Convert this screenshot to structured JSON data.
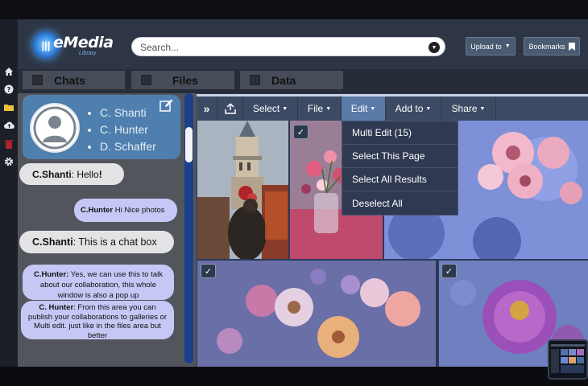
{
  "header": {
    "logo_text": "eMedia",
    "logo_sub": "Library",
    "search_placeholder": "Search...",
    "upload_label": "Upload to",
    "bookmarks_label": "Bookmarks"
  },
  "tabs": [
    {
      "label": "Chats"
    },
    {
      "label": "Files"
    },
    {
      "label": "Data"
    }
  ],
  "rail_icons": [
    "home-icon",
    "help-icon",
    "folder-icon",
    "cloud-upload-icon",
    "trash-icon",
    "settings-icon"
  ],
  "chat": {
    "contacts": [
      "C. Shanti",
      "C. Hunter",
      "D. Schaffer"
    ],
    "messages": [
      {
        "sender": "C.Shanti",
        "text": ": Hello",
        "tail": "!"
      },
      {
        "sender": "C.Hunter",
        "text": " Hi Nice photos"
      },
      {
        "sender": "C.Shanti",
        "text": ": This is a chat box"
      },
      {
        "sender": "C.Hunter:",
        "text": " Yes, we can use this to talk about our collaboration, this whole window is also a pop up"
      },
      {
        "sender": "C. Hunter",
        "text": ": From this area you can publish your collaborations to galleries or Multi edit. just like in the files area but better"
      }
    ]
  },
  "toolbar": {
    "expand": "»",
    "select": "Select",
    "file": "File",
    "edit": "Edit",
    "add_to": "Add to",
    "share": "Share"
  },
  "edit_menu": [
    "Multi Edit (15)",
    "Select This Page",
    "Select All Results",
    "Deselect All"
  ],
  "colors": {
    "accent_blue": "#4e7fae",
    "toolbar": "#3d4a63",
    "active_tab": "#5a7aa8",
    "scrollbar": "#1c3f8c"
  }
}
